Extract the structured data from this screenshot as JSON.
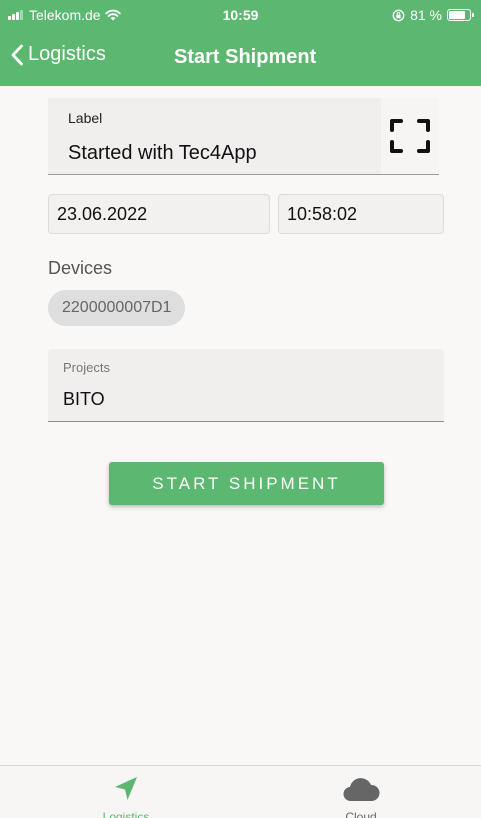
{
  "status_bar": {
    "carrier": "Telekom.de",
    "time": "10:59",
    "battery_text": "81 %",
    "battery_level": 0.81
  },
  "nav": {
    "back_label": "Logistics",
    "title": "Start Shipment"
  },
  "form": {
    "label_caption": "Label",
    "label_value": "Started with Tec4App",
    "date_value": "23.06.2022",
    "time_value": "10:58:02",
    "devices_label": "Devices",
    "device_chip": "2200000007D1",
    "projects_caption": "Projects",
    "projects_value": "BITO",
    "start_button": "START SHIPMENT"
  },
  "tabbar": {
    "tabs": [
      {
        "label": "Logistics",
        "icon": "navigation-arrow-icon",
        "active": true
      },
      {
        "label": "Cloud",
        "icon": "cloud-icon",
        "active": false
      }
    ]
  },
  "colors": {
    "accent": "#5cb870",
    "background": "#faf7f7"
  }
}
